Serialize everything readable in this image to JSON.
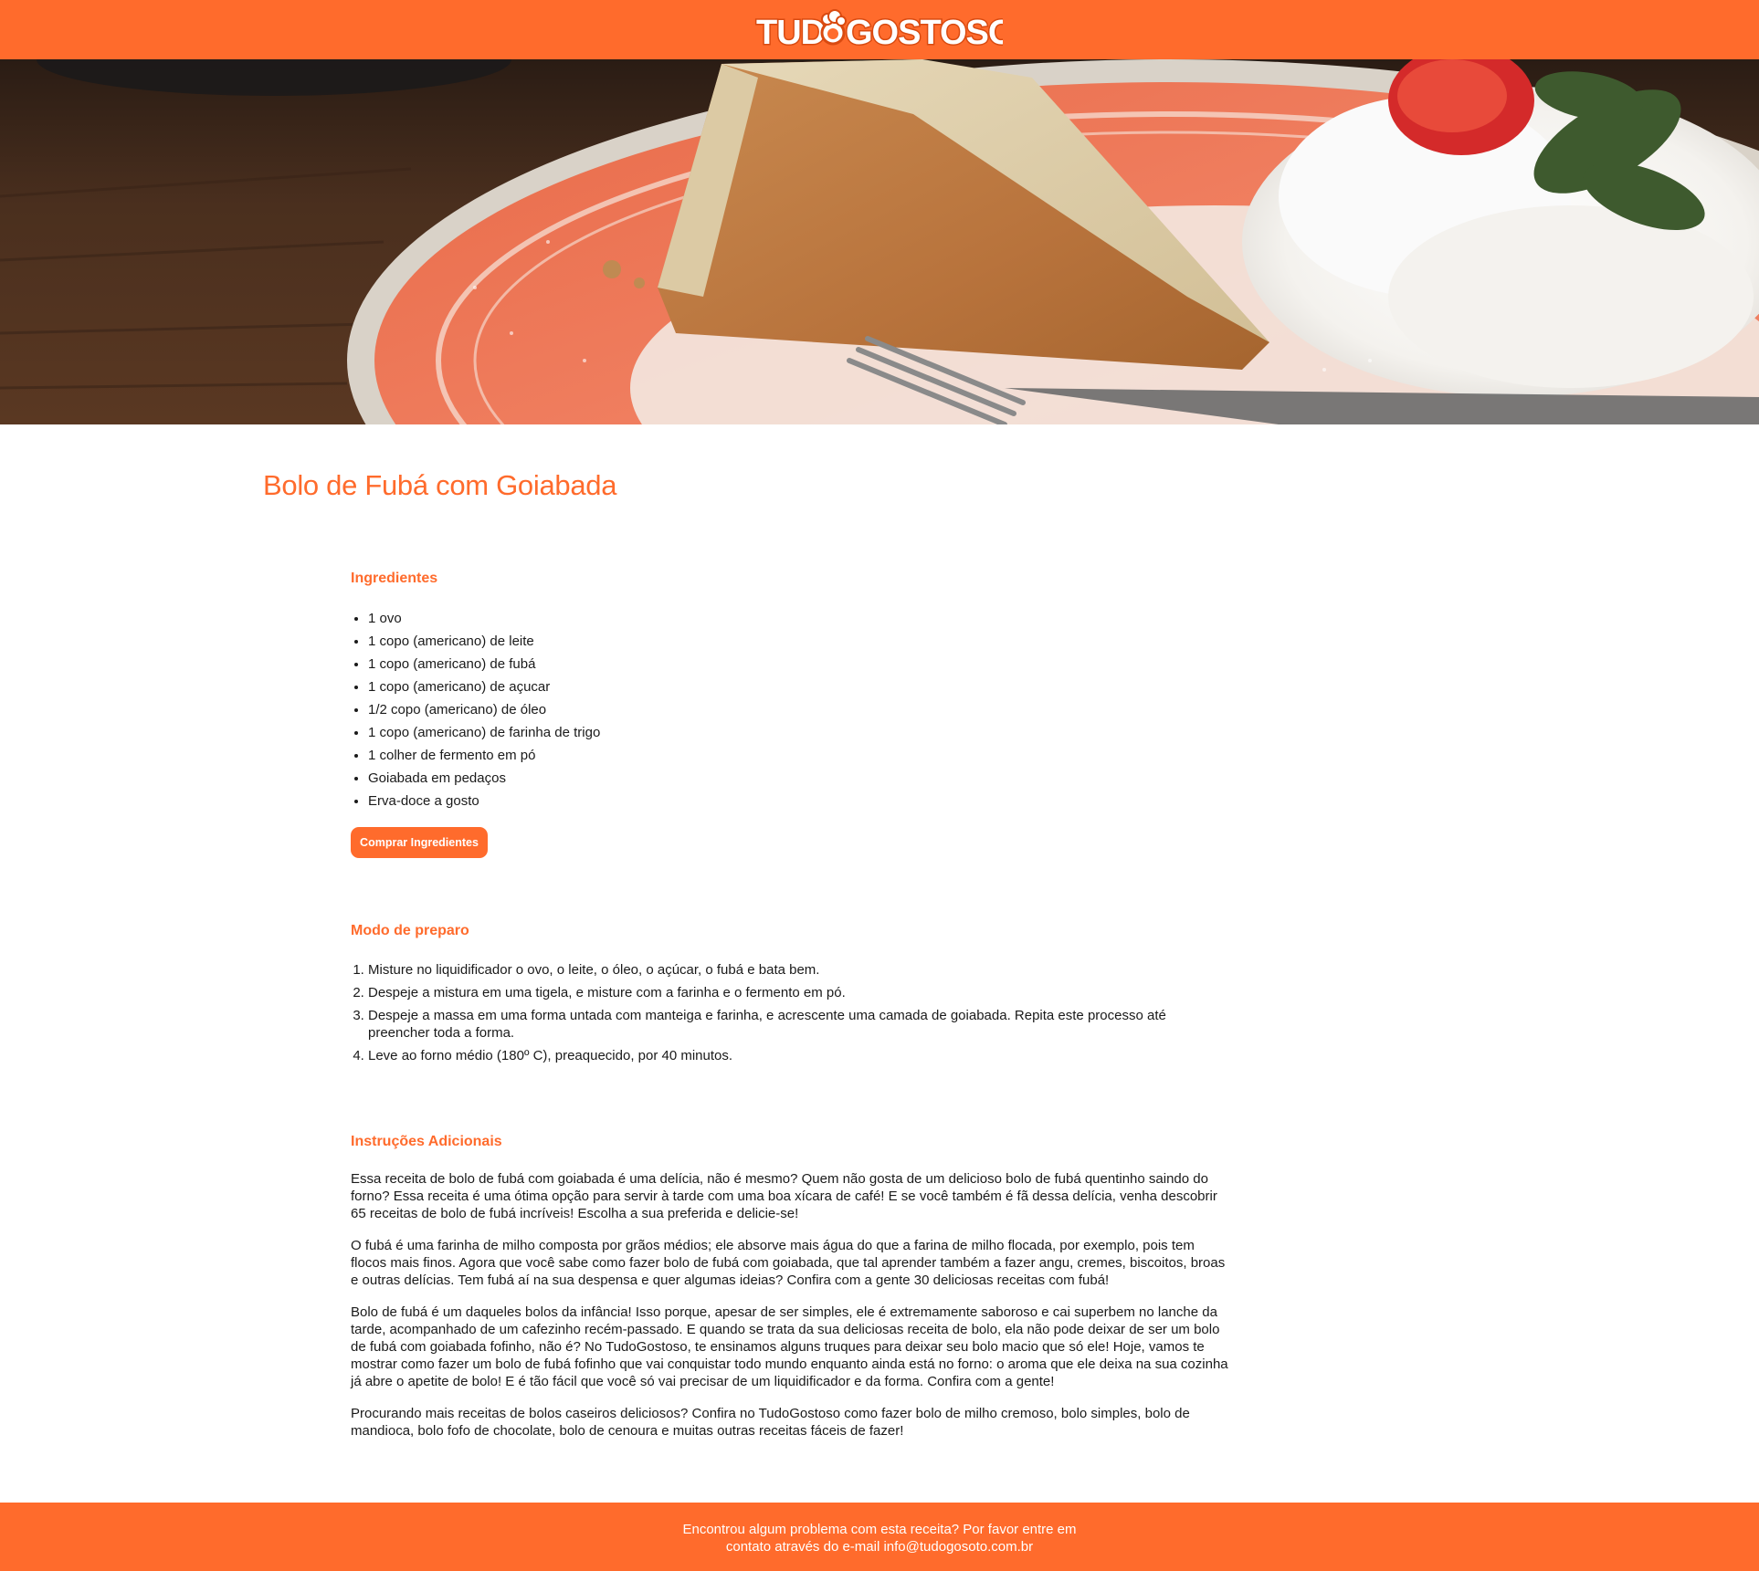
{
  "header": {
    "logo_text": "TUDOGOSTOSO",
    "logo_icon": "chef-hat-icon"
  },
  "hero": {
    "image": "cake-slice-photo"
  },
  "recipe": {
    "title": "Bolo de Fubá com Goiabada"
  },
  "ingredients": {
    "heading": "Ingredientes",
    "items": [
      "1 ovo",
      "1 copo (americano) de leite",
      "1 copo (americano) de fubá",
      "1 copo (americano) de açucar",
      "1/2 copo (americano) de óleo",
      "1 copo (americano) de farinha de trigo",
      "1 colher de fermento em pó",
      "Goiabada em pedaços",
      "Erva-doce a gosto"
    ],
    "buy_button": "Comprar Ingredientes"
  },
  "preparo": {
    "heading": "Modo de preparo",
    "steps": [
      "Misture no liquidificador o ovo, o leite, o óleo, o açúcar, o fubá e bata bem.",
      "Despeje a mistura em uma tigela, e misture com a farinha e o fermento em pó.",
      "Despeje a massa em uma forma untada com manteiga e farinha, e acrescente uma camada de goiabada. Repita este processo até preencher toda a forma.",
      "Leve ao forno médio (180º C), preaquecido, por 40 minutos."
    ]
  },
  "adicionais": {
    "heading": "Instruções Adicionais",
    "paragraphs": [
      "Essa receita de bolo de fubá com goiabada é uma delícia, não é mesmo? Quem não gosta de um delicioso bolo de fubá quentinho saindo do forno? Essa receita é uma ótima opção para servir à tarde com uma boa xícara de café! E se você também é fã dessa delícia, venha descobrir 65 receitas de bolo de fubá incríveis! Escolha a sua preferida e delicie-se!",
      "O fubá é uma farinha de milho composta por grãos médios; ele absorve mais água do que a farina de milho flocada, por exemplo, pois tem flocos mais finos. Agora que você sabe como fazer bolo de fubá com goiabada, que tal aprender também a fazer angu, cremes, biscoitos, broas e outras delícias. Tem fubá aí na sua despensa e quer algumas ideias? Confira com a gente 30 deliciosas receitas com fubá!",
      "Bolo de fubá é um daqueles bolos da infância! Isso porque, apesar de ser simples, ele é extremamente saboroso e cai superbem no lanche da tarde, acompanhado de um cafezinho recém-passado. E quando se trata da sua deliciosas receita de bolo, ela não pode deixar de ser um bolo de fubá com goiabada fofinho, não é? No TudoGostoso, te ensinamos alguns truques para deixar seu bolo macio que só ele! Hoje, vamos te mostrar como fazer um bolo de fubá fofinho que vai conquistar todo mundo enquanto ainda está no forno: o aroma que ele deixa na sua cozinha já abre o apetite de bolo! E é tão fácil que você só vai precisar de um liquidificador e da forma. Confira com a gente!",
      "Procurando mais receitas de bolos caseiros deliciosos? Confira no TudoGostoso como fazer bolo de milho cremoso, bolo simples, bolo de mandioca, bolo fofo de chocolate, bolo de cenoura e muitas outras receitas fáceis de fazer!"
    ]
  },
  "footer": {
    "line1": "Encontrou algum problema com esta receita? Por favor entre em",
    "line2": "contato através do e-mail info@tudogosoto.com.br"
  },
  "colors": {
    "brand": "#ff6b2c",
    "text": "#1a1a1a",
    "white": "#ffffff"
  }
}
